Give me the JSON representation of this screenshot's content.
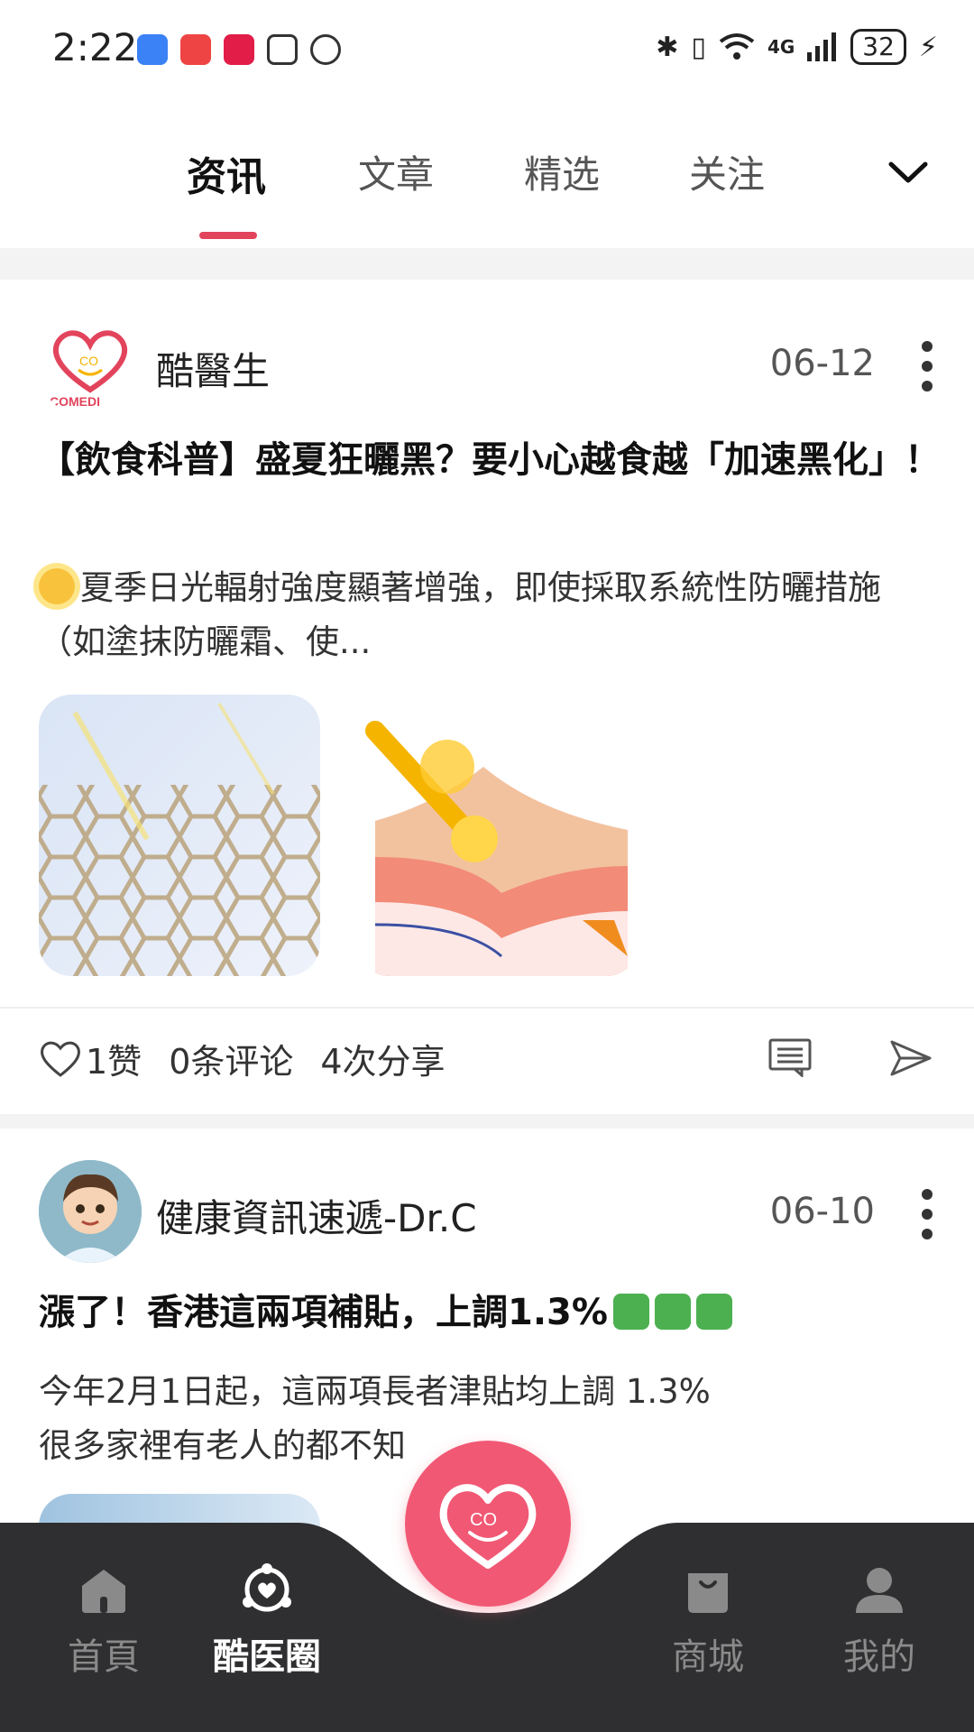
{
  "status_bar": {
    "time": "2:22",
    "network": "4G",
    "battery": "32"
  },
  "tabs": [
    {
      "label": "资讯",
      "active": true
    },
    {
      "label": "文章",
      "active": false
    },
    {
      "label": "精选",
      "active": false
    },
    {
      "label": "关注",
      "active": false
    }
  ],
  "posts": [
    {
      "author": "酷醫生",
      "avatar_logo_text": "COMEDI HEALTH",
      "date": "06-12",
      "title": "【飲食科普】盛夏狂曬黑？要小心越食越「加速黑化」！",
      "excerpt": "夏季日光輻射強度顯著增強，即使採取系統性防曬措施（如塗抹防曬霜、使...",
      "excerpt_icon": "sun-emoji",
      "likes": "1赞",
      "comments": "0条评论",
      "shares": "4次分享"
    },
    {
      "author": "健康資訊速遞-Dr.C",
      "date": "06-10",
      "title": "漲了！香港這兩項補貼，上調1.3%",
      "title_emoji": "chart-increasing-emoji",
      "excerpt_line1": "今年2月1日起，這兩項長者津貼均上調 1.3%",
      "excerpt_line2": "很多家裡有老人的都不知"
    }
  ],
  "bottom_nav": [
    {
      "label": "首頁",
      "icon": "home-icon",
      "active": false
    },
    {
      "label": "酷医圈",
      "icon": "circle-heart-icon",
      "active": true
    },
    {
      "label": "商城",
      "icon": "shopping-bag-icon",
      "active": false
    },
    {
      "label": "我的",
      "icon": "user-icon",
      "active": false
    }
  ],
  "colors": {
    "accent": "#e2445c",
    "fab": "#f15874",
    "nav_bg": "#2f2f31"
  }
}
